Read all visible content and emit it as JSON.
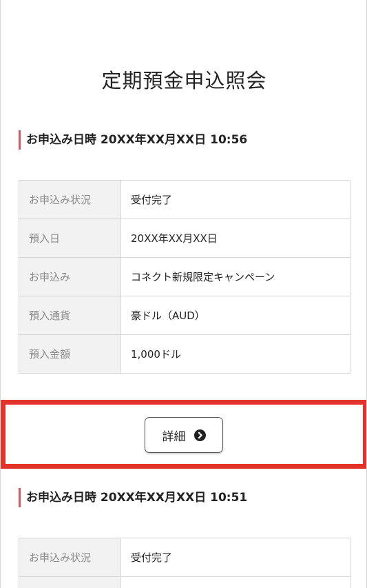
{
  "page": {
    "title": "定期預金申込照会"
  },
  "applications": [
    {
      "heading": "お申込み日時 20XX年XX月XX日 10:56",
      "rows": [
        {
          "label": "お申込み状況",
          "value": "受付完了"
        },
        {
          "label": "預入日",
          "value": "20XX年XX月XX日"
        },
        {
          "label": "お申込み",
          "value": "コネクト新規限定キャンペーン"
        },
        {
          "label": "預入通貨",
          "value": "豪ドル（AUD）"
        },
        {
          "label": "預入金額",
          "value": "1,000ドル"
        }
      ],
      "detail_label": "詳細",
      "detail_icon": "chevron-right-circle-icon"
    },
    {
      "heading": "お申込み日時 20XX年XX月XX日 10:51",
      "rows": [
        {
          "label": "お申込み状況",
          "value": "受付完了"
        }
      ]
    }
  ],
  "colors": {
    "accent_bar": "#e0525c",
    "highlight_border": "#e2342b",
    "label_background": "#f2f2f2"
  }
}
